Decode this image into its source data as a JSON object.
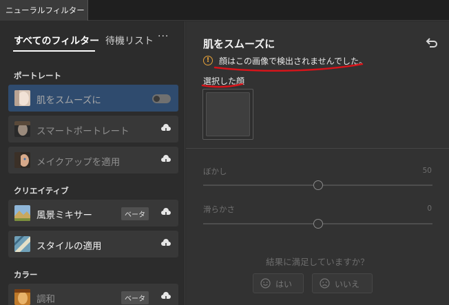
{
  "window": {
    "tab_title": "ニューラルフィルター"
  },
  "left_panel": {
    "tabs": [
      {
        "label": "すべてのフィルター"
      },
      {
        "label": "待機リスト"
      }
    ],
    "more_label": "···",
    "sections": [
      {
        "label": "ポートレート",
        "items": [
          {
            "label": "肌をスムーズに",
            "state": "selected"
          },
          {
            "label": "スマートポートレート",
            "state": "cloud"
          },
          {
            "label": "メイクアップを適用",
            "state": "cloud"
          }
        ]
      },
      {
        "label": "クリエイティブ",
        "items": [
          {
            "label": "風景ミキサー",
            "badge": "ベータ",
            "state": "cloud"
          },
          {
            "label": "スタイルの適用",
            "state": "cloud"
          }
        ]
      },
      {
        "label": "カラー",
        "items": [
          {
            "label": "調和",
            "badge": "ベータ",
            "state": "cloud"
          }
        ]
      }
    ]
  },
  "right_panel": {
    "title": "肌をスムーズに",
    "warning_text": "顔はこの画像で検出されませんでした。",
    "face_label": "選択した顔",
    "sliders": [
      {
        "label": "ぼかし",
        "value": "50",
        "fraction": 0.5
      },
      {
        "label": "滑らかさ",
        "value": "0",
        "fraction": 0.5
      }
    ],
    "feedback": {
      "question": "結果に満足していますか？",
      "yes_label": "はい",
      "no_label": "いいえ"
    }
  },
  "colors": {
    "accent_selected": "#2f4b6e",
    "warning": "#e8a33a",
    "annotation_red": "#d7141a"
  }
}
